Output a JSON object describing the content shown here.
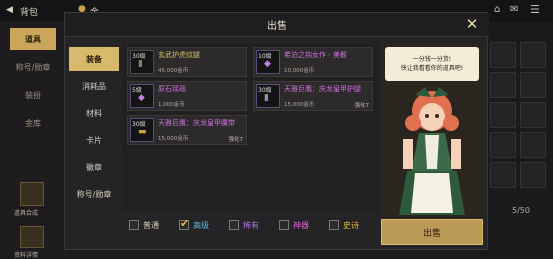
{
  "topbar": {
    "back_label": "背包",
    "back_suffix": "金"
  },
  "left_tabs": [
    "道具",
    "称号/勋章",
    "装扮",
    "金库"
  ],
  "left_bottom": [
    "道具合成",
    "资料详情"
  ],
  "dialog": {
    "title": "出售",
    "categories": [
      "装备",
      "消耗品",
      "材料",
      "卡片",
      "徽章",
      "称号/勋章"
    ],
    "active_category": 0,
    "items": [
      {
        "level": "30级",
        "name": "玄武护虎纹腿",
        "price": "45,000金币",
        "enhance": "",
        "color": "#d8c060"
      },
      {
        "level": "10级",
        "name": "希泊之钩女作 - 美髫",
        "price": "10,000金币",
        "enhance": "",
        "color": "#d070e0"
      },
      {
        "level": "5级",
        "name": "原石瑶瑙",
        "price": "1,000金币",
        "enhance": "",
        "color": "#d070e0"
      },
      {
        "level": "30级",
        "name": "天雅巨鹰：庆龙皇甲护腿",
        "price": "15,000金币",
        "enhance": "强化7",
        "color": "#d070e0"
      },
      {
        "level": "30级",
        "name": "天雅巨鹰：庆龙皇甲腰带",
        "price": "15,000金币",
        "enhance": "强化7",
        "color": "#d070e0"
      }
    ],
    "filters": [
      {
        "label": "普通",
        "checked": false,
        "color": "#d8d0c0"
      },
      {
        "label": "高级",
        "checked": true,
        "color": "#5fb8e0"
      },
      {
        "label": "稀有",
        "checked": false,
        "color": "#b070e0"
      },
      {
        "label": "神器",
        "checked": false,
        "color": "#e060d0"
      },
      {
        "label": "史诗",
        "checked": false,
        "color": "#e8b840"
      }
    ],
    "npc_speech": [
      "一分钱一分货!",
      "快让我看看你的道具吧!"
    ],
    "sell_button": "出售"
  },
  "page_counter": "5/50"
}
